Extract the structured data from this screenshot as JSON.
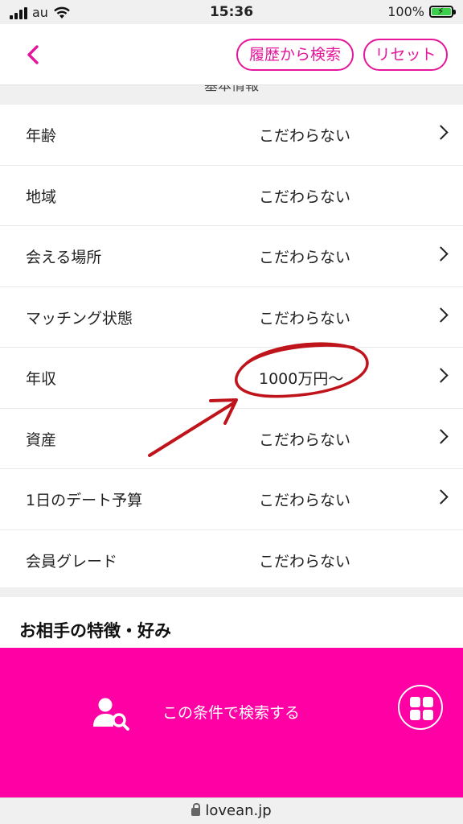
{
  "status_bar": {
    "carrier": "au",
    "time": "15:36",
    "battery": "100%",
    "battery_level": 1.0
  },
  "header": {
    "back_icon": "chevron-left-icon",
    "history_search_label": "履歴から検索",
    "reset_label": "リセット"
  },
  "section_header": "基本情報",
  "conditions": [
    {
      "label": "年齢",
      "value": "こだわらない",
      "has_chevron": true
    },
    {
      "label": "地域",
      "value": "こだわらない",
      "has_chevron": false
    },
    {
      "label": "会える場所",
      "value": "こだわらない",
      "has_chevron": true
    },
    {
      "label": "マッチング状態",
      "value": "こだわらない",
      "has_chevron": true
    },
    {
      "label": "年収",
      "value": "1000万円〜",
      "has_chevron": true
    },
    {
      "label": "資産",
      "value": "こだわらない",
      "has_chevron": true
    },
    {
      "label": "1日のデート予算",
      "value": "こだわらない",
      "has_chevron": true
    },
    {
      "label": "会員グレード",
      "value": "こだわらない",
      "has_chevron": false
    }
  ],
  "features_title": "お相手の特徴・好み",
  "search_bar": {
    "icon": "user-search-icon",
    "label": "この条件で検索する",
    "menu_icon": "grid-menu-icon"
  },
  "url_bar": {
    "url": "lovean.jp",
    "icon": "lock-icon"
  },
  "colors": {
    "accent": "#e5159c",
    "search_bar_bg": "#ff00a5",
    "annotation": "#c0141c"
  }
}
